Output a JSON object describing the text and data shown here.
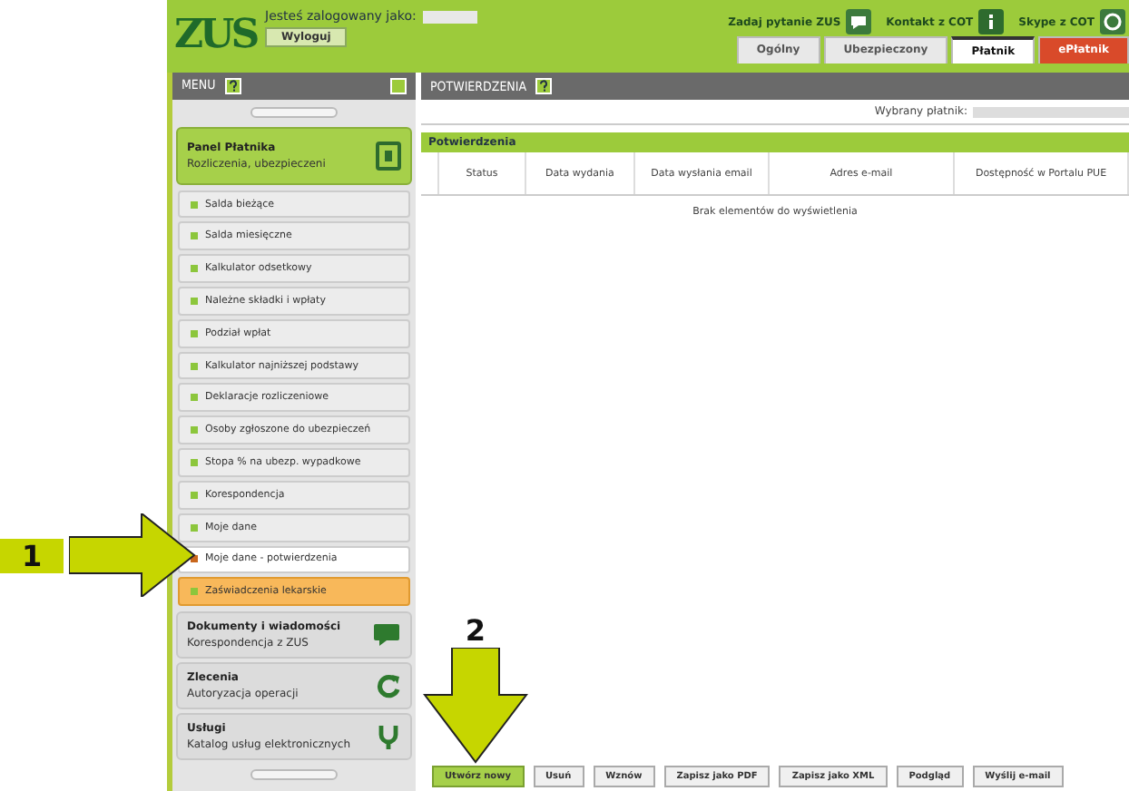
{
  "header": {
    "logo": "ZUS",
    "logged_in_label": "Jesteś zalogowany jako:",
    "logout_button": "Wyloguj",
    "links": [
      {
        "label": "Zadaj pytanie ZUS"
      },
      {
        "label": "Kontakt z COT"
      },
      {
        "label": "Skype z COT"
      }
    ],
    "tabs": [
      {
        "label": "Ogólny",
        "selected": false,
        "kind": "normal"
      },
      {
        "label": "Ubezpieczony",
        "selected": false,
        "kind": "normal"
      },
      {
        "label": "Płatnik",
        "selected": true,
        "kind": "normal"
      },
      {
        "label": "ePłatnik",
        "selected": false,
        "kind": "red"
      }
    ]
  },
  "menu": {
    "title": "MENU",
    "sections": [
      {
        "title": "Panel Płatnika",
        "subtitle": "Rozliczenia, ubezpieczeni",
        "expanded": true,
        "items": [
          {
            "label": "Salda bieżące",
            "selected": false,
            "highlighted": false
          },
          {
            "label": "Salda miesięczne",
            "selected": false,
            "highlighted": false
          },
          {
            "label": "Kalkulator odsetkowy",
            "selected": false,
            "highlighted": false
          },
          {
            "label": "Należne składki i wpłaty",
            "selected": false,
            "highlighted": false
          },
          {
            "label": "Podział wpłat",
            "selected": false,
            "highlighted": false
          },
          {
            "label": "Kalkulator najniższej podstawy",
            "selected": false,
            "highlighted": false
          },
          {
            "label": "Deklaracje rozliczeniowe",
            "selected": false,
            "highlighted": false
          },
          {
            "label": "Osoby zgłoszone do ubezpieczeń",
            "selected": false,
            "highlighted": false
          },
          {
            "label": "Stopa % na ubezp. wypadkowe",
            "selected": false,
            "highlighted": false
          },
          {
            "label": "Korespondencja",
            "selected": false,
            "highlighted": false
          },
          {
            "label": "Moje dane",
            "selected": false,
            "highlighted": false
          },
          {
            "label": "Moje dane - potwierdzenia",
            "selected": true,
            "highlighted": false
          },
          {
            "label": "Zaświadczenia lekarskie",
            "selected": false,
            "highlighted": true
          }
        ]
      },
      {
        "title": "Dokumenty i wiadomości",
        "subtitle": "Korespondencja z ZUS",
        "expanded": false
      },
      {
        "title": "Zlecenia",
        "subtitle": "Autoryzacja operacji",
        "expanded": false
      },
      {
        "title": "Usługi",
        "subtitle": "Katalog usług elektronicznych",
        "expanded": false
      }
    ]
  },
  "content": {
    "title": "POTWIERDZENIA",
    "payer_label": "Wybrany płatnik:",
    "table": {
      "title": "Potwierdzenia",
      "columns": [
        "Status",
        "Data wydania",
        "Data wysłania email",
        "Adres e-mail",
        "Dostępność w Portalu PUE"
      ],
      "empty_message": "Brak elementów do wyświetlenia"
    },
    "buttons": [
      {
        "label": "Utwórz nowy",
        "kind": "primary"
      },
      {
        "label": "Usuń",
        "kind": "normal"
      },
      {
        "label": "Wznów",
        "kind": "normal"
      },
      {
        "label": "Zapisz jako PDF",
        "kind": "normal"
      },
      {
        "label": "Zapisz jako XML",
        "kind": "normal"
      },
      {
        "label": "Podgląd",
        "kind": "normal"
      },
      {
        "label": "Wyślij e-mail",
        "kind": "normal"
      }
    ]
  },
  "annotations": [
    {
      "number": "1"
    },
    {
      "number": "2"
    }
  ]
}
